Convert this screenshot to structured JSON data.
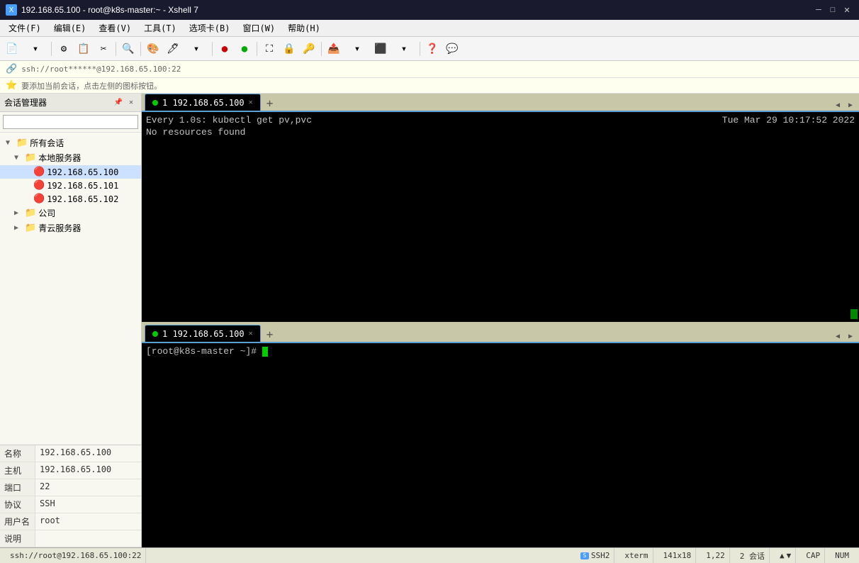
{
  "titleBar": {
    "title": "192.168.65.100 - root@k8s-master:~ - Xshell 7",
    "icon": "X",
    "minimizeBtn": "─",
    "maximizeBtn": "□",
    "closeBtn": "✕"
  },
  "menuBar": {
    "items": [
      "文件(F)",
      "编辑(E)",
      "查看(V)",
      "工具(T)",
      "选项卡(B)",
      "窗口(W)",
      "帮助(H)"
    ]
  },
  "addressBar": {
    "address": "ssh://root******@192.168.65.100:22"
  },
  "notifyBar": {
    "message": "要添加当前会话，点击左侧的图标按钮。"
  },
  "sidebar": {
    "title": "会话管理器",
    "searchPlaceholder": "",
    "tree": [
      {
        "level": 0,
        "type": "root",
        "label": "所有会话",
        "arrow": "▼",
        "icon": "📁"
      },
      {
        "level": 1,
        "type": "folder",
        "label": "本地服务器",
        "arrow": "▼",
        "icon": "📁"
      },
      {
        "level": 2,
        "type": "server",
        "label": "192.168.65.100",
        "arrow": "",
        "icon": "🔴"
      },
      {
        "level": 2,
        "type": "server",
        "label": "192.168.65.101",
        "arrow": "",
        "icon": "🔴"
      },
      {
        "level": 2,
        "type": "server",
        "label": "192.168.65.102",
        "arrow": "",
        "icon": "🔴"
      },
      {
        "level": 1,
        "type": "folder",
        "label": "公司",
        "arrow": "▶",
        "icon": "📁"
      },
      {
        "level": 1,
        "type": "folder",
        "label": "青云服务器",
        "arrow": "▶",
        "icon": "📁"
      }
    ],
    "info": {
      "rows": [
        {
          "key": "名称",
          "val": "192.168.65.100"
        },
        {
          "key": "主机",
          "val": "192.168.65.100"
        },
        {
          "key": "端口",
          "val": "22"
        },
        {
          "key": "协议",
          "val": "SSH"
        },
        {
          "key": "用户名",
          "val": "root"
        },
        {
          "key": "说明",
          "val": ""
        }
      ]
    }
  },
  "terminal1": {
    "tabLabel": "1 192.168.65.100",
    "commandLine": "Every 1.0s: kubectl get pv,pvc",
    "timestamp": "Tue Mar 29 10:17:52 2022",
    "output": "No resources found"
  },
  "terminal2": {
    "tabLabel": "1 192.168.65.100",
    "prompt": "[root@k8s-master ~]# "
  },
  "statusBar": {
    "path": "ssh://root@192.168.65.100:22",
    "protocol": "SSH2",
    "terminal": "xterm",
    "dimensions": "141x18",
    "position": "1,22",
    "sessions": "2 会话",
    "caps": "CAP",
    "num": "NUM"
  }
}
